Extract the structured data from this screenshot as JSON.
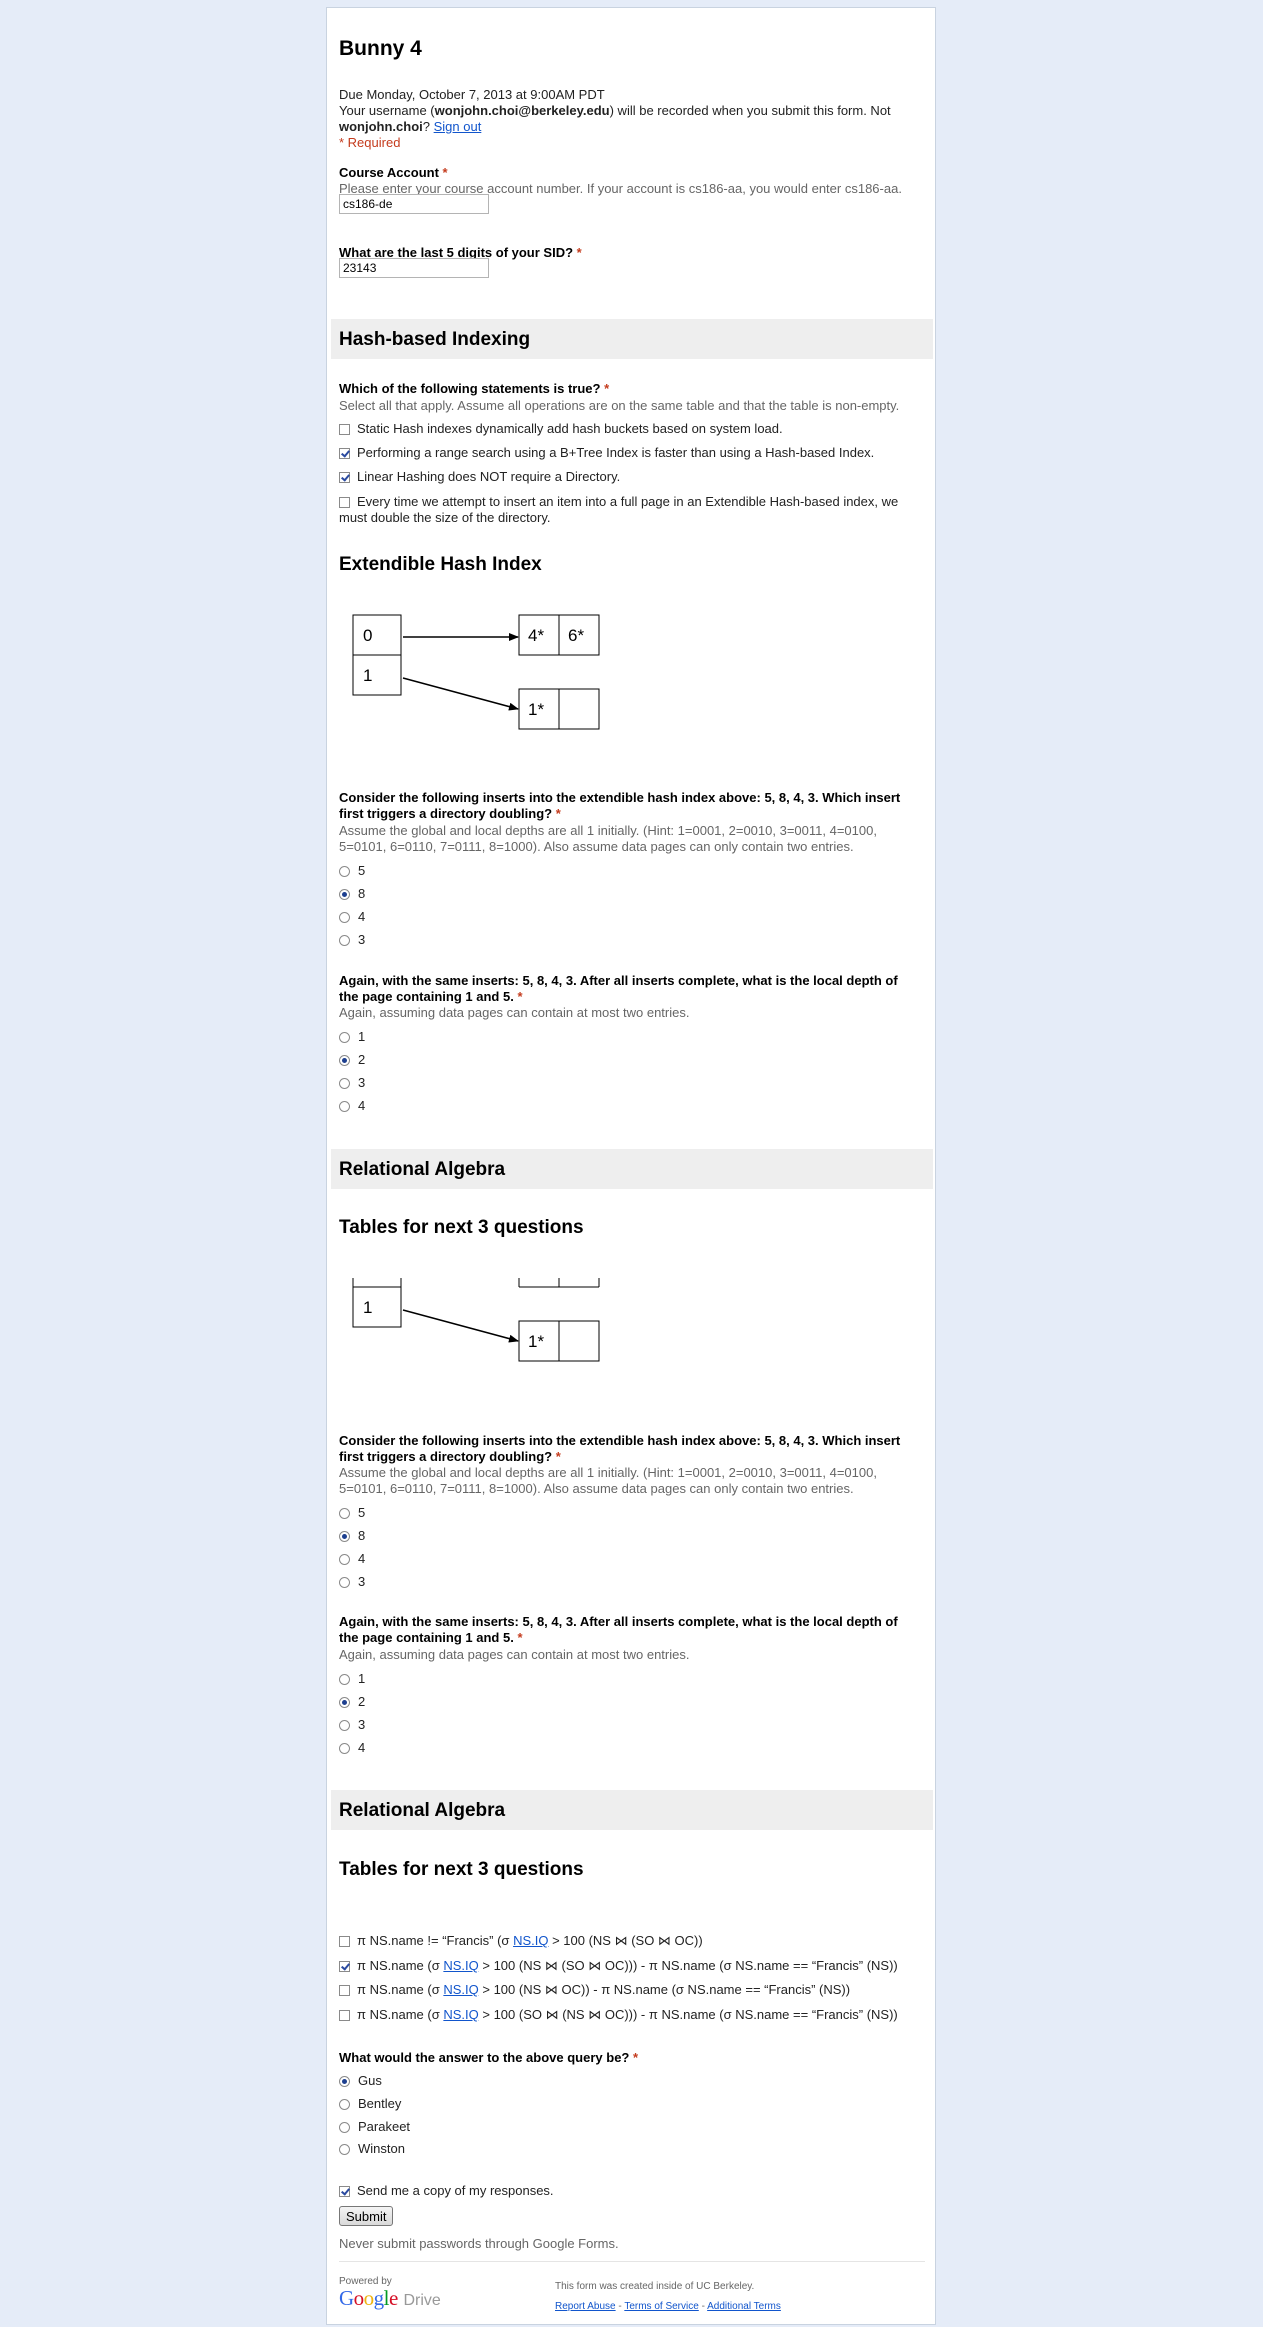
{
  "form": {
    "title": "Bunny 4",
    "due": "Due Monday, October 7, 2013 at 9:00AM PDT",
    "username_pre": "Your username (",
    "username_email": "wonjohn.choi@berkeley.edu",
    "username_post": ") will be recorded when you submit this form. Not",
    "username_name": "wonjohn.choi",
    "username_q": "?",
    "sign_out": "Sign out",
    "required_note": "* Required",
    "req_star": "*"
  },
  "course_account": {
    "label": "Course Account",
    "help": "Please enter your course account number. If your account is cs186-aa, you would enter cs186-aa.",
    "value": "cs186-de"
  },
  "sid": {
    "label": "What are the last 5 digits of your SID?",
    "value": "23143"
  },
  "section1": {
    "title": "Hash-based Indexing"
  },
  "statements": {
    "label": "Which of the following statements is true?",
    "help": "Select all that apply. Assume all operations are on the same table and that the table is non-empty.",
    "options": [
      {
        "label": "Static Hash indexes dynamically add hash buckets based on system load.",
        "checked": false
      },
      {
        "label": "Performing a range search using a B+Tree Index is faster than using a Hash-based Index.",
        "checked": true
      },
      {
        "label": "Linear Hashing does NOT require a Directory.",
        "checked": true
      },
      {
        "label": "Every time we attempt to insert an item into a full page in an Extendible Hash-based index, we must double the size of the directory.",
        "checked": false
      }
    ]
  },
  "ehi": {
    "heading": "Extendible Hash Index",
    "dir": [
      "0",
      "1"
    ],
    "bucket_a": [
      "4*",
      "6*"
    ],
    "bucket_b": [
      "1*",
      ""
    ]
  },
  "q_doubling": {
    "label": "Consider the following inserts into the extendible hash index above: 5, 8, 4, 3. Which insert first triggers a directory doubling?",
    "help": "Assume the global and local depths are all 1 initially. (Hint: 1=0001, 2=0010, 3=0011, 4=0100, 5=0101, 6=0110, 7=0111, 8=1000). Also assume data pages can only contain two entries.",
    "options": [
      "5",
      "8",
      "4",
      "3"
    ],
    "selected": 1
  },
  "q_depth": {
    "label": "Again, with the same inserts: 5, 8, 4, 3. After all inserts complete, what is the local depth of the page containing 1 and 5.",
    "help": "Again, assuming data pages can contain at most two entries.",
    "options": [
      "1",
      "2",
      "3",
      "4"
    ],
    "selected": 1
  },
  "section2": {
    "title": "Relational Algebra"
  },
  "tables_heading": "Tables for next 3 questions",
  "diagram2": {
    "dir": [
      "1"
    ],
    "bucket_b": [
      "1*",
      ""
    ]
  },
  "ra_options": [
    {
      "checked": false,
      "parts": [
        "π NS.name != “Francis” (σ ",
        "NS.IQ",
        " > 100 (NS ⋈ (SO ⋈ OC))"
      ]
    },
    {
      "checked": true,
      "parts": [
        "π NS.name (σ ",
        "NS.IQ",
        " > 100 (NS ⋈ (SO ⋈ OC))) - π NS.name (σ NS.name == “Francis” (NS))"
      ]
    },
    {
      "checked": false,
      "parts": [
        "π NS.name (σ ",
        "NS.IQ",
        " > 100 (NS ⋈ OC)) - π NS.name (σ NS.name == “Francis” (NS))"
      ]
    },
    {
      "checked": false,
      "parts": [
        "π NS.name (σ ",
        "NS.IQ",
        " > 100 (SO ⋈ (NS ⋈ OC))) - π NS.name (σ NS.name == “Francis” (NS))"
      ]
    }
  ],
  "q_answer": {
    "label": "What would the answer to the above query be?",
    "options": [
      "Gus",
      "Bentley",
      "Parakeet",
      "Winston"
    ],
    "selected": 0
  },
  "send_copy": {
    "label": "Send me a copy of my responses.",
    "checked": true
  },
  "submit": {
    "label": "Submit",
    "warning": "Never submit passwords through Google Forms."
  },
  "footer": {
    "powered_by": "Powered by",
    "google": "Google",
    "drive": "Drive",
    "created_inside": "This form was created inside of UC Berkeley.",
    "report_abuse": "Report Abuse",
    "terms": "Terms of Service",
    "additional_terms": "Additional Terms",
    "sep": " - "
  },
  "colors": {
    "background": "#e5ecf8",
    "section_bar": "#eeeeee",
    "required": "#c43b1d",
    "link": "#1155cc"
  }
}
